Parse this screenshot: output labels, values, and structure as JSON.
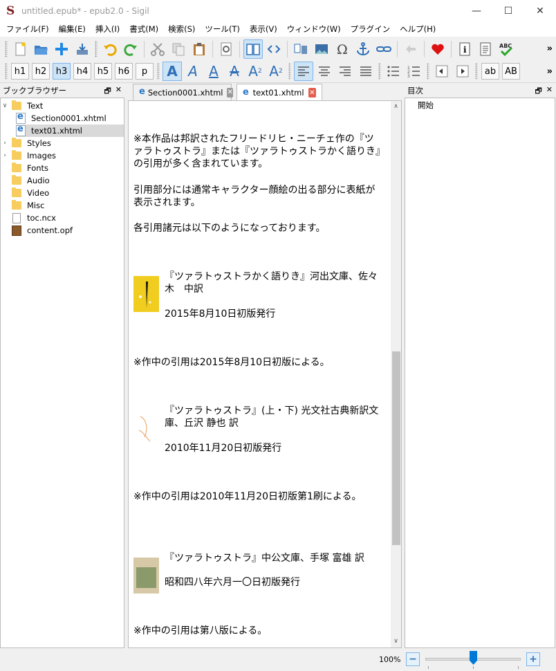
{
  "window": {
    "title": "untitled.epub* - epub2.0 - Sigil",
    "minimize": "—",
    "maximize": "☐",
    "close": "✕"
  },
  "menu": [
    "ファイル(F)",
    "編集(E)",
    "挿入(I)",
    "書式(M)",
    "検索(S)",
    "ツール(T)",
    "表示(V)",
    "ウィンドウ(W)",
    "プラグイン",
    "ヘルプ(H)"
  ],
  "toolbar2": {
    "headings": [
      "h1",
      "h2",
      "h3",
      "h4",
      "h5",
      "h6",
      "p"
    ],
    "active_heading": "h3",
    "case_lower": "ab",
    "case_upper": "AB"
  },
  "book_browser": {
    "title": "ブックブラウザー",
    "items": [
      {
        "label": "Text",
        "type": "folder",
        "expanded": true
      },
      {
        "label": "Section0001.xhtml",
        "type": "xhtml"
      },
      {
        "label": "text01.xhtml",
        "type": "xhtml",
        "selected": true
      },
      {
        "label": "Styles",
        "type": "folder"
      },
      {
        "label": "Images",
        "type": "folder"
      },
      {
        "label": "Fonts",
        "type": "folder"
      },
      {
        "label": "Audio",
        "type": "folder"
      },
      {
        "label": "Video",
        "type": "folder"
      },
      {
        "label": "Misc",
        "type": "folder"
      },
      {
        "label": "toc.ncx",
        "type": "file"
      },
      {
        "label": "content.opf",
        "type": "opf"
      }
    ]
  },
  "tabs": [
    {
      "label": "Section0001.xhtml",
      "active": false
    },
    {
      "label": "text01.xhtml",
      "active": true
    }
  ],
  "editor": {
    "paragraphs": [
      "※本作品は邦訳されたフリードリヒ・ニーチェ作の『ツァラトゥストラ』または『ツァラトゥストラかく語りき』の引用が多く含まれています。",
      "引用部分には通常キャラクター顔絵の出る部分に表紙が表示されます。",
      "各引用諸元は以下のようになっております。",
      "『ツァラトゥストラかく語りき』河出文庫、佐々木　中訳",
      "2015年8月10日初版発行",
      "※作中の引用は2015年8月10日初版による。",
      "『ツァラトゥストラ』(上・下) 光文社古典新訳文庫、丘沢 静也 訳",
      "2010年11月20日初版発行",
      "※作中の引用は2010年11月20日初版第1刷による。",
      "『ツァラトゥストラ』中公文庫、手塚 富雄 訳",
      "昭和四八年六月一〇日初版発行",
      "※作中の引用は第八版による。"
    ]
  },
  "toc": {
    "title": "目次",
    "entries": [
      "開始"
    ]
  },
  "status": {
    "zoom": "100%",
    "zoom_level": 0.5
  },
  "colors": {
    "accent": "#0078d7",
    "folder": "#f6cd5e",
    "active_bg": "#cde4f7"
  }
}
